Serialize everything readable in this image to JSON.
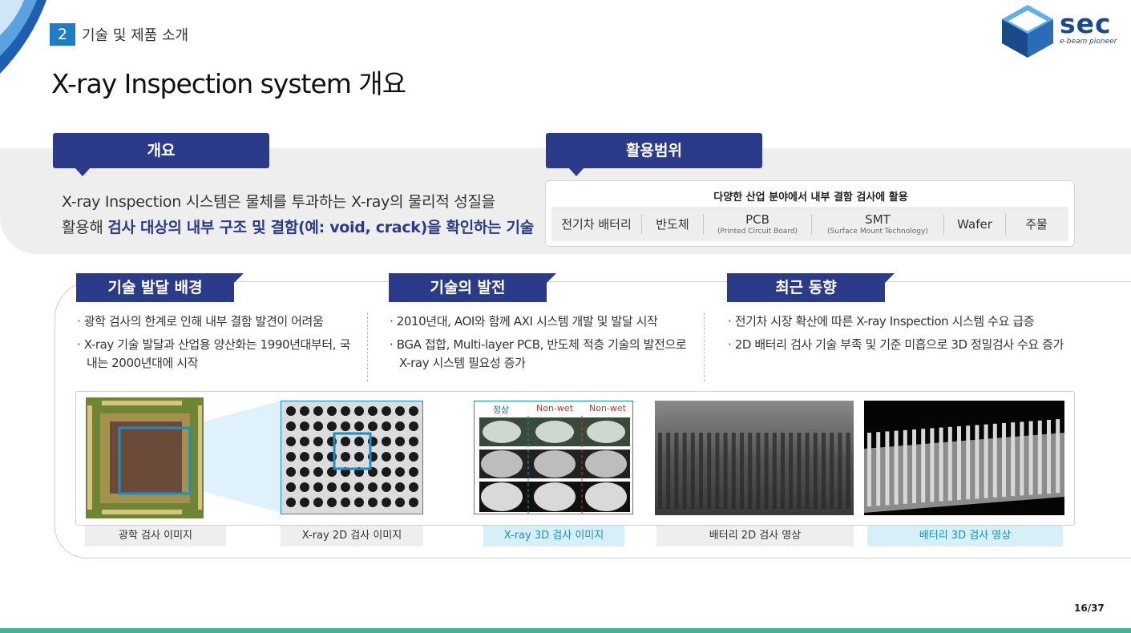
{
  "header": {
    "section_number": "2",
    "section_title": "기술 및 제품 소개",
    "page_title": "X-ray Inspection system 개요"
  },
  "logo": {
    "text": "sec",
    "tagline": "e-beam pioneer"
  },
  "overview": {
    "label": "개요",
    "line1": "X-ray Inspection 시스템은 물체를 투과하는 X-ray의 물리적 성질을",
    "line2_plain": "활용해 ",
    "line2_bold": "검사 대상의 내부 구조 및 결함(예: void, crack)을 확인하는 기술"
  },
  "applications": {
    "label": "활용범위",
    "heading": "다양한 산업 분야에서 내부 결함 검사에 활용",
    "items": [
      {
        "name": "전기차 배터리",
        "sub": ""
      },
      {
        "name": "반도체",
        "sub": ""
      },
      {
        "name": "PCB",
        "sub": "(Printed Circuit Board)"
      },
      {
        "name": "SMT",
        "sub": "(Surface Mount Technology)"
      },
      {
        "name": "Wafer",
        "sub": ""
      },
      {
        "name": "주물",
        "sub": ""
      }
    ]
  },
  "columns": [
    {
      "label": "기술 발달 배경",
      "bullets": [
        "· 광학 검사의 한계로 인해 내부 결함 발견이 어려움",
        "· X-ray 기술 발달과 산업용 양산화는 1990년대부터, 국내는 2000년대에 시작"
      ]
    },
    {
      "label": "기술의 발전",
      "bullets": [
        "· 2010년대, AOI와 함께 AXI 시스템 개발 및 발달 시작",
        "· BGA 접합, Multi-layer PCB, 반도체 적층 기술의 발전으로 X-ray 시스템 필요성 증가"
      ]
    },
    {
      "label": "최근 동향",
      "bullets": [
        "· 전기차 시장 확산에 따른 X-ray Inspection 시스템 수요 급증",
        "· 2D 배터리 검사 기술 부족 및 기준 미흡으로 3D 정밀검사 수요 증가"
      ]
    }
  ],
  "images": {
    "labels_3d": [
      "정상",
      "Non-wet",
      "Non-wet"
    ],
    "captions": [
      "광학 검사 이미지",
      "X-ray 2D 검사 이미지",
      "X-ray 3D 검사 이미지",
      "배터리 2D 검사 영상",
      "배터리 3D 검사 영상"
    ]
  },
  "footer": {
    "page": "16/37"
  },
  "colors": {
    "navy": "#2b3b8a",
    "blue": "#1f7cc7",
    "cyan": "#1a8fc4",
    "green_bar": "#3fb594"
  }
}
